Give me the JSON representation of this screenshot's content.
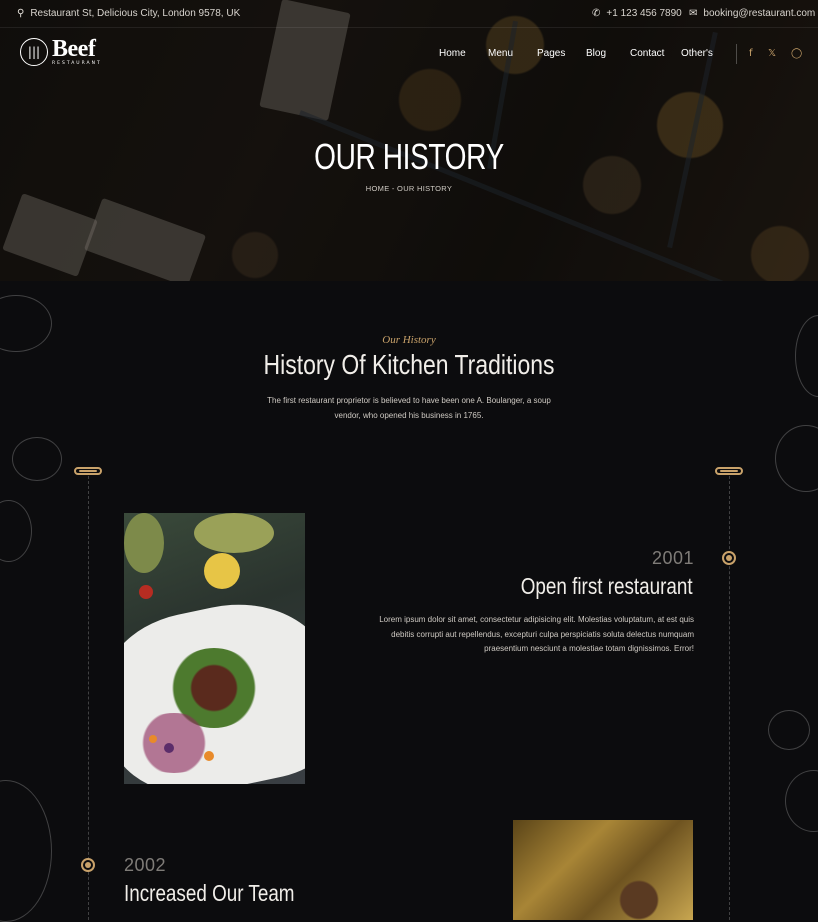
{
  "topbar": {
    "address": "Restaurant St, Delicious City, London 9578, UK",
    "phone": "+1 123 456 7890",
    "email": "booking@restaurant.com"
  },
  "logo": {
    "name": "Beef",
    "sub": "RESTAURANT"
  },
  "nav": {
    "items": [
      "Home",
      "Menu",
      "Pages",
      "Blog",
      "Contact",
      "Other's"
    ]
  },
  "social": [
    "facebook-icon",
    "x-icon",
    "instagram-icon"
  ],
  "hero": {
    "title": "OUR HISTORY",
    "breadcrumb": "HOME - OUR HISTORY"
  },
  "section": {
    "kicker": "Our History",
    "title": "History Of Kitchen Traditions",
    "description": "The first restaurant proprietor is believed to have been one A. Boulanger, a soup vendor, who opened his business in 1765."
  },
  "timeline": [
    {
      "year": "2001",
      "title": "Open first restaurant",
      "text": "Lorem ipsum dolor sit amet, consectetur adipisicing elit. Molestias voluptatum, at est quis debitis corrupti aut repellendus, excepturi culpa perspiciatis soluta delectus numquam praesentium nesciunt a molestiae totam dignissimos. Error!"
    },
    {
      "year": "2002",
      "title": "Increased Our Team"
    }
  ],
  "colors": {
    "accent": "#c9a26a",
    "background": "#0c0c0e"
  }
}
